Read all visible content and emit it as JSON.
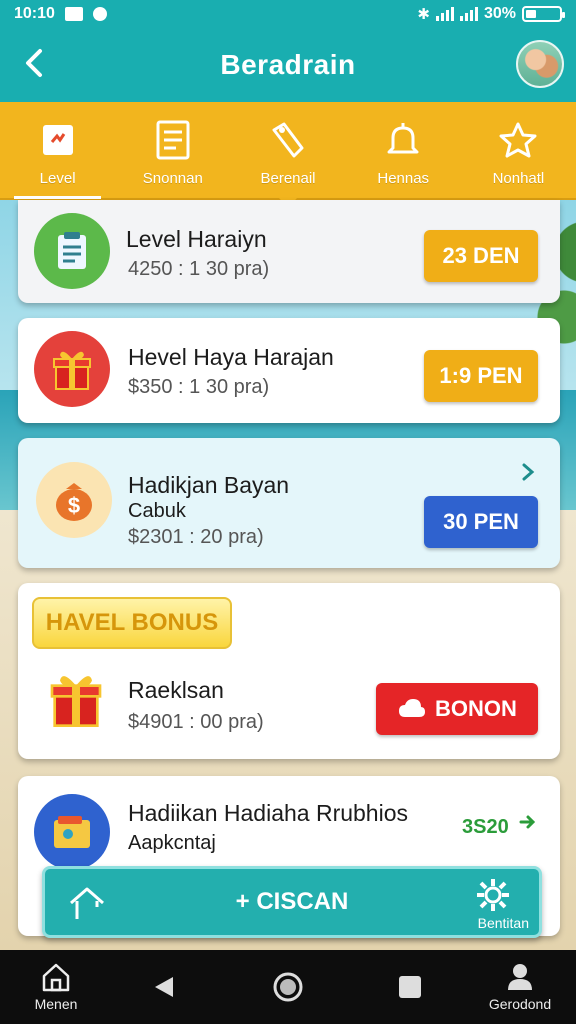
{
  "status_bar": {
    "time": "10:10",
    "battery": "30%",
    "battery_level": 0.3
  },
  "app_bar": {
    "title": "Beradrain"
  },
  "tabs": [
    {
      "label": "Level",
      "icon": "level-icon"
    },
    {
      "label": "Snonnan",
      "icon": "list-icon"
    },
    {
      "label": "Berenail",
      "icon": "tag-icon"
    },
    {
      "label": "Hennas",
      "icon": "bell-icon"
    },
    {
      "label": "Nonhatl",
      "icon": "star-icon"
    }
  ],
  "cards": [
    {
      "title": "Level Haraiyn",
      "subtitle": "4250 : 1 30 pra)",
      "button": "23 DEN",
      "icon": "clipboard-icon"
    },
    {
      "title": "Hevel Haya Harajan",
      "subtitle": "$350 : 1 30 pra)",
      "button": "1:9 PEN",
      "icon": "gift-icon"
    },
    {
      "title": "Hadikjan Bayan",
      "subtitle": "Cabuk",
      "subtitle2": "$2301 : 20 pra)",
      "button": "30 PEN",
      "icon": "money-bag-icon"
    },
    {
      "tag": "HAVEL BONUS",
      "title": "Raeklsan",
      "subtitle": "$4901 : 00 pra)",
      "button": "BONON",
      "icon": "gift-icon"
    },
    {
      "title": "Hadiikan Hadiaha Rrubhios",
      "subtitle": "Aapkcntaj",
      "promo": "3S20",
      "icon": "wallet-icon"
    }
  ],
  "action_bar": {
    "center_label": "+ CISCAN",
    "right_label": "Bentitan"
  },
  "nav": {
    "left_label": "Menen",
    "right_label": "Gerodond"
  },
  "colors": {
    "teal": "#19aeb0",
    "gold": "#f2b51e",
    "blue": "#2f62cf",
    "red": "#e52527",
    "green": "#2b9c3a"
  }
}
